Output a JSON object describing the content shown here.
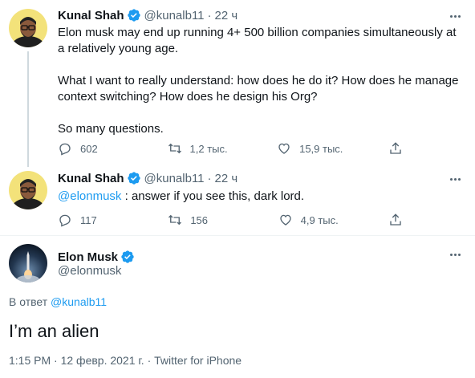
{
  "colors": {
    "accent": "#1d9bf0",
    "text_primary": "#0f1419",
    "text_secondary": "#536471",
    "divider": "#eff3f4",
    "thread_line": "#cfd9de"
  },
  "tweets": [
    {
      "name": "Kunal Shah",
      "handle": "@kunalb11",
      "separator": "·",
      "time": "22 ч",
      "paragraphs": [
        "Elon musk may end up running 4+ 500 billion companies simultaneously at a relatively young age.",
        "What I want to really understand: how does he do it? How does he manage context switching? How does he design his Org?",
        "So many questions."
      ],
      "actions": {
        "replies": "602",
        "retweets": "1,2 тыс.",
        "likes": "15,9 тыс."
      },
      "icons": [
        "verified-badge-icon",
        "more-icon",
        "reply-icon",
        "retweet-icon",
        "like-icon",
        "share-icon"
      ]
    },
    {
      "name": "Kunal Shah",
      "handle": "@kunalb11",
      "separator": "·",
      "time": "22 ч",
      "mention": "@elonmusk",
      "text": " : answer if you see this, dark lord.",
      "actions": {
        "replies": "117",
        "retweets": "156",
        "likes": "4,9 тыс."
      }
    }
  ],
  "main_tweet": {
    "name": "Elon Musk",
    "handle": "@elonmusk",
    "reply_prefix": "В ответ",
    "reply_handle": "@kunalb11",
    "text": "I’m an alien",
    "time": "1:15 PM",
    "date": "12 февр. 2021 г.",
    "source": "Twitter for iPhone",
    "separator": "·"
  }
}
